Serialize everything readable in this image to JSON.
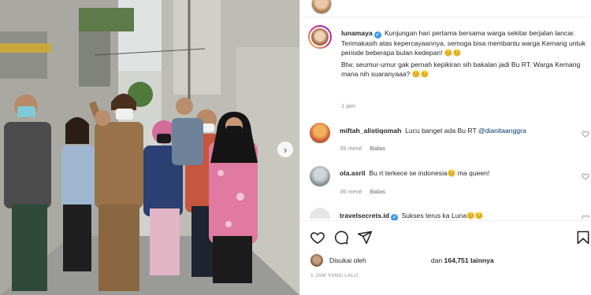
{
  "post": {
    "photo": {
      "alt_icon": "photo",
      "next_icon": "chevron-right-icon"
    },
    "caption": {
      "username": "lunamaya",
      "verified": true,
      "paragraph1": "Kunjungan hari pertama bersama warga sekitar berjalan lancar. Terimakasih atas kepercayaannya, semoga bisa membantu warga Kemang untuk periode beberapa bulan kedepan! 😊😊",
      "paragraph2": "Btw, seumur-umur gak pernah kepikiran sih bakalan jadi Bu RT. Warga Kemang mana nih suaranyaaa? 😊😊",
      "time": "1 jam"
    },
    "comments": [
      {
        "username": "miftah_alistiqomah",
        "text": "Lucu banget ada Bu RT",
        "mention": "@dianitaanggra",
        "time": "39 menit",
        "reply": "Balas"
      },
      {
        "username": "ola.asril",
        "text": "Bu rt terkece se indonesia😊 ma queen!",
        "mention": "",
        "time": "36 menit",
        "reply": "Balas"
      },
      {
        "username": "travelsecrets.id",
        "verified": true,
        "text": "Sukses terus ka Luna😊😊",
        "mention": "",
        "time": "",
        "reply": ""
      }
    ],
    "actions": {
      "like_icon": "heart-icon",
      "comment_icon": "comment-icon",
      "share_icon": "share-icon",
      "save_icon": "bookmark-icon"
    },
    "likes": {
      "prefix": "Disukai oleh",
      "connector": "dan",
      "count": "164,751",
      "suffix": "lainnya"
    },
    "posted_time": "1 JAM YANG LALU"
  },
  "colors": {
    "verified": "#3897f0",
    "muted": "#8e8e8e",
    "mention": "#00376b",
    "text": "#262626"
  }
}
